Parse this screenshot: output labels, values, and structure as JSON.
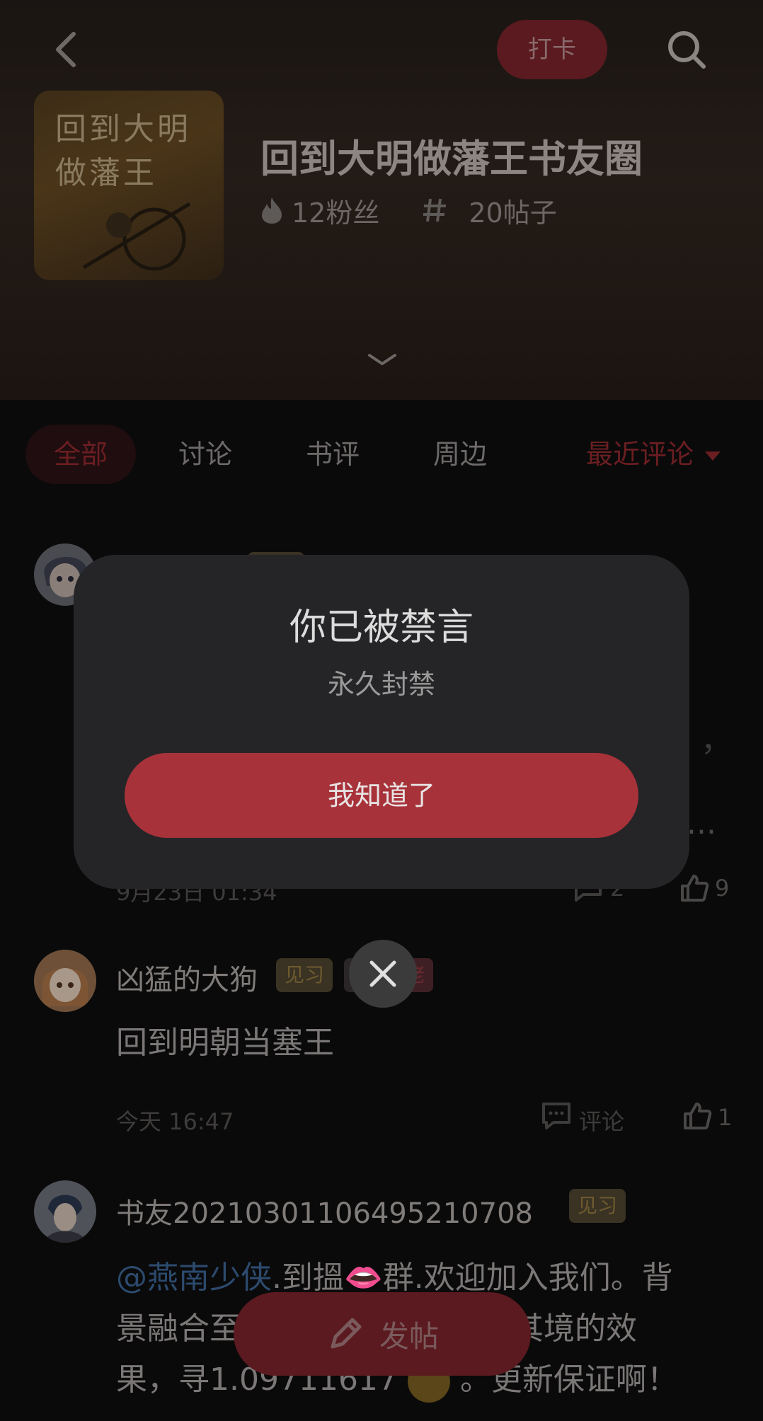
{
  "header": {
    "checkin_label": "打卡",
    "circle_title": "回到大明做藩王书友圈",
    "cover_text": "回到大明做藩王",
    "fans": "12粉丝",
    "posts": "20帖子"
  },
  "tabs": {
    "all": "全部",
    "discuss": "讨论",
    "review": "书评",
    "merch": "周边",
    "sort": "最近评论"
  },
  "posts": [
    {
      "name": "",
      "content_tail1": "，",
      "content_tail2": "...",
      "time": "9月23日 01:34",
      "comments": "2",
      "likes": "9"
    },
    {
      "name": "凶猛的大狗",
      "badge1": "见习",
      "badge2": "佬",
      "content": "回到明朝当塞王",
      "time": "今天 16:47",
      "comment_label": "评论",
      "likes": "1"
    },
    {
      "name": "书友20210301106495210708",
      "badge1": "见习",
      "mention": "@燕南少侠",
      "content_line1": ".到搵👄群.欢迎加入我们。背",
      "content_line2_a": "景融合至",
      "content_line2_b": "临其境的效",
      "content_line3_a": "果，寻1.09711617",
      "content_line3_b": "。更新保证啊！"
    }
  ],
  "modal": {
    "title": "你已被禁言",
    "subtitle": "永久封禁",
    "button": "我知道了"
  },
  "fab": {
    "label": "发帖"
  }
}
